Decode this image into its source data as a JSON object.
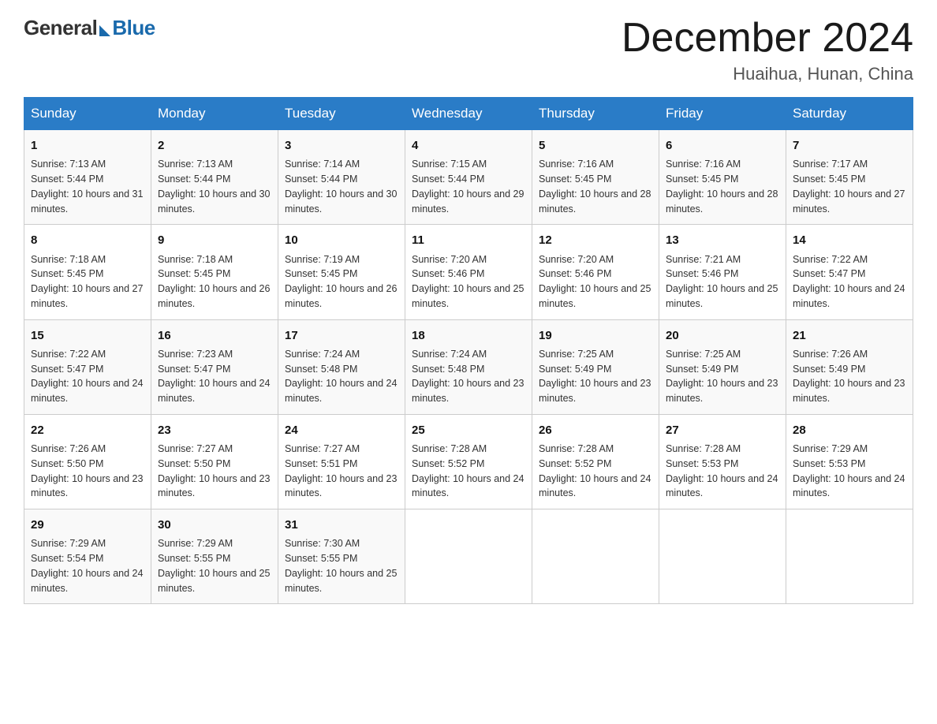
{
  "logo": {
    "general": "General",
    "blue": "Blue"
  },
  "title": "December 2024",
  "location": "Huaihua, Hunan, China",
  "days_of_week": [
    "Sunday",
    "Monday",
    "Tuesday",
    "Wednesday",
    "Thursday",
    "Friday",
    "Saturday"
  ],
  "weeks": [
    [
      {
        "day": "1",
        "sunrise": "7:13 AM",
        "sunset": "5:44 PM",
        "daylight": "10 hours and 31 minutes."
      },
      {
        "day": "2",
        "sunrise": "7:13 AM",
        "sunset": "5:44 PM",
        "daylight": "10 hours and 30 minutes."
      },
      {
        "day": "3",
        "sunrise": "7:14 AM",
        "sunset": "5:44 PM",
        "daylight": "10 hours and 30 minutes."
      },
      {
        "day": "4",
        "sunrise": "7:15 AM",
        "sunset": "5:44 PM",
        "daylight": "10 hours and 29 minutes."
      },
      {
        "day": "5",
        "sunrise": "7:16 AM",
        "sunset": "5:45 PM",
        "daylight": "10 hours and 28 minutes."
      },
      {
        "day": "6",
        "sunrise": "7:16 AM",
        "sunset": "5:45 PM",
        "daylight": "10 hours and 28 minutes."
      },
      {
        "day": "7",
        "sunrise": "7:17 AM",
        "sunset": "5:45 PM",
        "daylight": "10 hours and 27 minutes."
      }
    ],
    [
      {
        "day": "8",
        "sunrise": "7:18 AM",
        "sunset": "5:45 PM",
        "daylight": "10 hours and 27 minutes."
      },
      {
        "day": "9",
        "sunrise": "7:18 AM",
        "sunset": "5:45 PM",
        "daylight": "10 hours and 26 minutes."
      },
      {
        "day": "10",
        "sunrise": "7:19 AM",
        "sunset": "5:45 PM",
        "daylight": "10 hours and 26 minutes."
      },
      {
        "day": "11",
        "sunrise": "7:20 AM",
        "sunset": "5:46 PM",
        "daylight": "10 hours and 25 minutes."
      },
      {
        "day": "12",
        "sunrise": "7:20 AM",
        "sunset": "5:46 PM",
        "daylight": "10 hours and 25 minutes."
      },
      {
        "day": "13",
        "sunrise": "7:21 AM",
        "sunset": "5:46 PM",
        "daylight": "10 hours and 25 minutes."
      },
      {
        "day": "14",
        "sunrise": "7:22 AM",
        "sunset": "5:47 PM",
        "daylight": "10 hours and 24 minutes."
      }
    ],
    [
      {
        "day": "15",
        "sunrise": "7:22 AM",
        "sunset": "5:47 PM",
        "daylight": "10 hours and 24 minutes."
      },
      {
        "day": "16",
        "sunrise": "7:23 AM",
        "sunset": "5:47 PM",
        "daylight": "10 hours and 24 minutes."
      },
      {
        "day": "17",
        "sunrise": "7:24 AM",
        "sunset": "5:48 PM",
        "daylight": "10 hours and 24 minutes."
      },
      {
        "day": "18",
        "sunrise": "7:24 AM",
        "sunset": "5:48 PM",
        "daylight": "10 hours and 23 minutes."
      },
      {
        "day": "19",
        "sunrise": "7:25 AM",
        "sunset": "5:49 PM",
        "daylight": "10 hours and 23 minutes."
      },
      {
        "day": "20",
        "sunrise": "7:25 AM",
        "sunset": "5:49 PM",
        "daylight": "10 hours and 23 minutes."
      },
      {
        "day": "21",
        "sunrise": "7:26 AM",
        "sunset": "5:49 PM",
        "daylight": "10 hours and 23 minutes."
      }
    ],
    [
      {
        "day": "22",
        "sunrise": "7:26 AM",
        "sunset": "5:50 PM",
        "daylight": "10 hours and 23 minutes."
      },
      {
        "day": "23",
        "sunrise": "7:27 AM",
        "sunset": "5:50 PM",
        "daylight": "10 hours and 23 minutes."
      },
      {
        "day": "24",
        "sunrise": "7:27 AM",
        "sunset": "5:51 PM",
        "daylight": "10 hours and 23 minutes."
      },
      {
        "day": "25",
        "sunrise": "7:28 AM",
        "sunset": "5:52 PM",
        "daylight": "10 hours and 24 minutes."
      },
      {
        "day": "26",
        "sunrise": "7:28 AM",
        "sunset": "5:52 PM",
        "daylight": "10 hours and 24 minutes."
      },
      {
        "day": "27",
        "sunrise": "7:28 AM",
        "sunset": "5:53 PM",
        "daylight": "10 hours and 24 minutes."
      },
      {
        "day": "28",
        "sunrise": "7:29 AM",
        "sunset": "5:53 PM",
        "daylight": "10 hours and 24 minutes."
      }
    ],
    [
      {
        "day": "29",
        "sunrise": "7:29 AM",
        "sunset": "5:54 PM",
        "daylight": "10 hours and 24 minutes."
      },
      {
        "day": "30",
        "sunrise": "7:29 AM",
        "sunset": "5:55 PM",
        "daylight": "10 hours and 25 minutes."
      },
      {
        "day": "31",
        "sunrise": "7:30 AM",
        "sunset": "5:55 PM",
        "daylight": "10 hours and 25 minutes."
      },
      null,
      null,
      null,
      null
    ]
  ],
  "labels": {
    "sunrise": "Sunrise:",
    "sunset": "Sunset:",
    "daylight": "Daylight:"
  }
}
